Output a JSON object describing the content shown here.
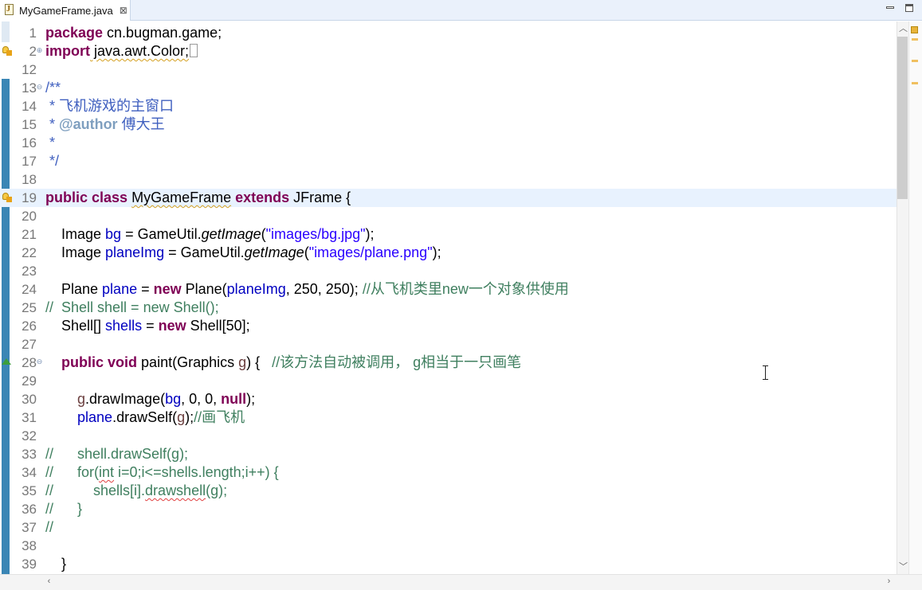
{
  "tab": {
    "label": "MyGameFrame.java",
    "close_glyph": "⊠",
    "icon": "java-file-icon"
  },
  "window_buttons": {
    "minimize": "minimize-icon",
    "maximize": "maximize-icon"
  },
  "lines": [
    {
      "num": "1",
      "pkg_kw": "package",
      "pkg_name": " cn.bugman.game;"
    },
    {
      "num": "2",
      "imp_kw": "import",
      "imp_name": " java.awt.Color;"
    },
    {
      "num": "12"
    },
    {
      "num": "13",
      "text": "/**"
    },
    {
      "num": "14",
      "text": " * 飞机游戏的主窗口"
    },
    {
      "num": "15",
      "pre": " * ",
      "tag": "@author",
      "post": " 傅大王"
    },
    {
      "num": "16",
      "text": " *"
    },
    {
      "num": "17",
      "text": " */"
    },
    {
      "num": "18"
    },
    {
      "num": "19",
      "kw1": "public",
      "kw2": "class",
      "name": "MyGameFrame",
      "kw3": "extends",
      "rest": " JFrame {"
    },
    {
      "num": "20"
    },
    {
      "num": "21",
      "type": "    Image ",
      "field": "bg",
      "eq": " = GameUtil.",
      "method": "getImage",
      "open": "(",
      "str": "\"images/bg.jpg\"",
      "close": ");"
    },
    {
      "num": "22",
      "type": "    Image ",
      "field": "planeImg",
      "eq": " = GameUtil.",
      "method": "getImage",
      "open": "(",
      "str": "\"images/plane.png\"",
      "close": ");"
    },
    {
      "num": "23"
    },
    {
      "num": "24",
      "type": "    Plane ",
      "field": "plane",
      "eq": " = ",
      "kw": "new",
      "mid": " Plane(",
      "arg": "planeImg",
      "args": ", 250, 250); ",
      "comment": "//从飞机类里new一个对象供使用"
    },
    {
      "num": "25",
      "comment": "//  Shell shell = new Shell();"
    },
    {
      "num": "26",
      "type": "    Shell[] ",
      "field": "shells",
      "eq": " = ",
      "kw": "new",
      "rest": " Shell[50];"
    },
    {
      "num": "27"
    },
    {
      "num": "28",
      "indent": "    ",
      "kw1": "public",
      "kw2": "void",
      "mid": " paint(Graphics ",
      "param": "g",
      "rest": ") {   ",
      "comment": "//该方法自动被调用， g相当于一只画笔"
    },
    {
      "num": "29"
    },
    {
      "num": "30",
      "indent": "        ",
      "param": "g",
      "mid": ".drawImage(",
      "field": "bg",
      "rest": ", 0, 0, ",
      "kw": "null",
      "end": ");"
    },
    {
      "num": "31",
      "indent": "        ",
      "field": "plane",
      "mid": ".drawSelf(",
      "param": "g",
      "rest": ");",
      "comment": "//画飞机"
    },
    {
      "num": "32"
    },
    {
      "num": "33",
      "c1": "//      shell.drawSelf(g);"
    },
    {
      "num": "34",
      "c1": "//      for(",
      "c2": "int",
      "c3": " i=0;i<=shells.length;i++) {"
    },
    {
      "num": "35",
      "c1": "//          shells[i].",
      "c2": "drawshell",
      "c3": "(g);"
    },
    {
      "num": "36",
      "c1": "//      }"
    },
    {
      "num": "37",
      "c1": "//"
    },
    {
      "num": "38"
    },
    {
      "num": "39",
      "text": "    }"
    }
  ]
}
